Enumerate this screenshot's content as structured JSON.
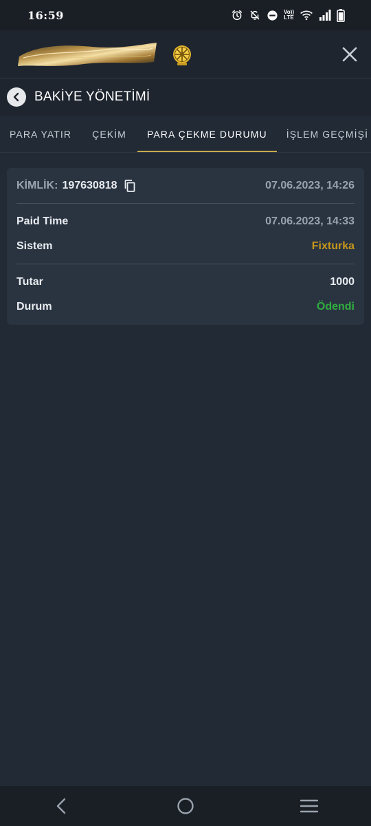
{
  "status_bar": {
    "time": "16:59",
    "volte_top": "Vo))",
    "volte_bottom": "LTE",
    "icons": [
      "alarm-icon",
      "notifications-off-icon",
      "do-not-disturb-icon",
      "volte-icon",
      "wifi-icon",
      "signal-icon",
      "battery-icon"
    ]
  },
  "header": {
    "close_icon": "close-icon"
  },
  "title_bar": {
    "back_icon": "chevron-left-icon",
    "title": "BAKİYE YÖNETİMİ"
  },
  "tabs": [
    {
      "label": "PARA YATIR",
      "active": false
    },
    {
      "label": "ÇEKİM",
      "active": false
    },
    {
      "label": "PARA ÇEKME DURUMU",
      "active": true
    },
    {
      "label": "İŞLEM GEÇMİŞİ",
      "active": false
    }
  ],
  "transaction": {
    "id_label": "KİMLİK:",
    "id_value": "197630818",
    "created": "07.06.2023, 14:26",
    "paid_time_label": "Paid Time",
    "paid_time_value": "07.06.2023, 14:33",
    "system_label": "Sistem",
    "system_value": "Fixturka",
    "amount_label": "Tutar",
    "amount_value": "1000",
    "status_label": "Durum",
    "status_value": "Ödendi"
  },
  "colors": {
    "accent_gold": "#c8a94e",
    "system_value": "#c7971c",
    "status_paid": "#2fae3e",
    "background": "#212a35",
    "card": "#2a3441"
  },
  "nav_bar": {
    "icons": [
      "back-icon",
      "home-icon",
      "recents-icon"
    ]
  }
}
